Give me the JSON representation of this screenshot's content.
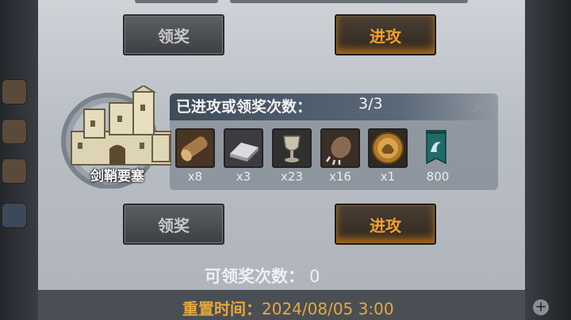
{
  "first_row": {
    "claim_button": "领奖",
    "attack_button": "进攻"
  },
  "stronghold": {
    "name": "剑鞘要塞",
    "count_label": "已进攻或领奖次数：",
    "count_value": "3/3",
    "rewards": [
      {
        "icon": "wood-log-icon",
        "qty": "x8"
      },
      {
        "icon": "iron-bar-icon",
        "qty": "x3"
      },
      {
        "icon": "goblet-icon",
        "qty": "x23"
      },
      {
        "icon": "beast-claw-icon",
        "qty": "x16"
      },
      {
        "icon": "helmet-medal-icon",
        "qty": "x1"
      },
      {
        "icon": "guild-banner-icon",
        "qty": "800"
      }
    ],
    "claim_button": "领奖",
    "attack_button": "进攻"
  },
  "available_claims": {
    "label": "可领奖次数：",
    "value": "0"
  },
  "reset": {
    "label": "重置时间：",
    "value": "2024/08/05 3:00"
  },
  "colors": {
    "attack_text": "#f0a030",
    "claim_text": "#c8c8c8",
    "reset_text": "#e6a83a"
  }
}
